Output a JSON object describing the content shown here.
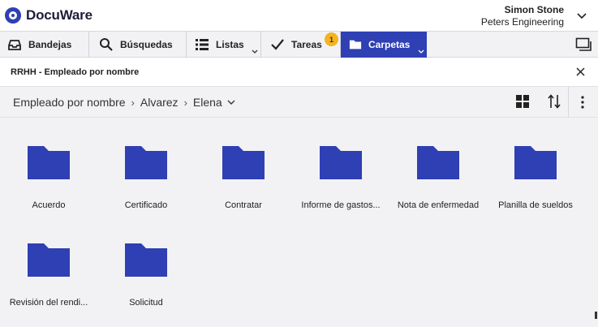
{
  "app": {
    "logo_text": "DocuWare",
    "brand_color": "#2f3fb4",
    "badge_color": "#f5b320"
  },
  "user": {
    "name": "Simon Stone",
    "company": "Peters Engineering"
  },
  "tabs": [
    {
      "label": "Bandejas",
      "icon": "tray-icon"
    },
    {
      "label": "Búsquedas",
      "icon": "search-icon"
    },
    {
      "label": "Listas",
      "icon": "list-icon"
    },
    {
      "label": "Tareas",
      "icon": "checkmark-icon",
      "badge": "1"
    },
    {
      "label": "Carpetas",
      "icon": "folder-icon",
      "active": true
    }
  ],
  "panel": {
    "title": "RRHH - Empleado por nombre"
  },
  "breadcrumb": {
    "items": [
      "Empleado por nombre",
      "Alvarez",
      "Elena"
    ],
    "separator": "›"
  },
  "folders": [
    {
      "label": "Acuerdo"
    },
    {
      "label": "Certificado"
    },
    {
      "label": "Contratar"
    },
    {
      "label": "Informe de gastos..."
    },
    {
      "label": "Nota de enfermedad"
    },
    {
      "label": "Planilla de sueldos"
    },
    {
      "label": "Revisión del rendi..."
    },
    {
      "label": "Solicitud"
    }
  ]
}
